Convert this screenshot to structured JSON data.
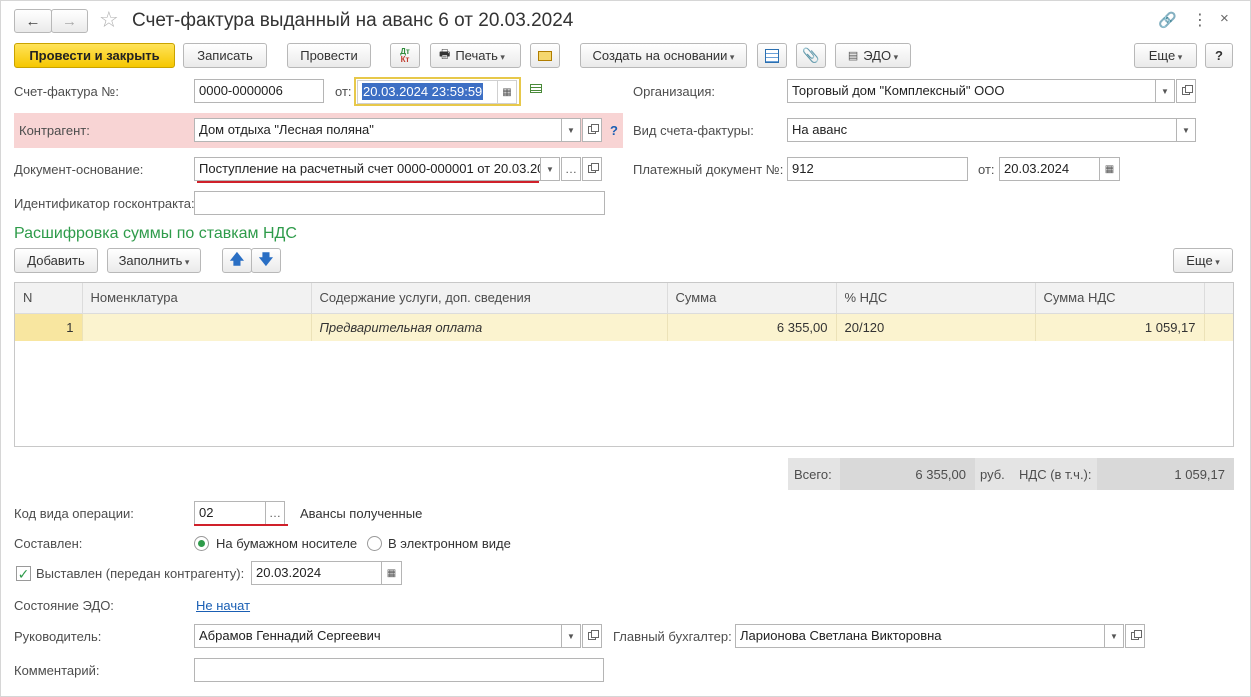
{
  "window": {
    "title": "Счет-фактура выданный на аванс 6 от 20.03.2024"
  },
  "toolbar": {
    "post_close": "Провести и закрыть",
    "save": "Записать",
    "post": "Провести",
    "dtkt_top": "Дт",
    "dtkt_bottom": "Кт",
    "print": "Печать",
    "create_based": "Создать на основании",
    "edo": "ЭДО",
    "more": "Еще",
    "help": "?"
  },
  "form": {
    "invoice_label": "Счет-фактура №:",
    "invoice_number": "0000-0000006",
    "from_label": "от:",
    "invoice_date": "20.03.2024 23:59:59",
    "org_label": "Организация:",
    "org_value": "Торговый дом \"Комплексный\" ООО",
    "counterparty_label": "Контрагент:",
    "counterparty_value": "Дом отдыха \"Лесная поляна\"",
    "question": "?",
    "invoice_type_label": "Вид счета-фактуры:",
    "invoice_type_value": "На аванс",
    "basis_label": "Документ-основание:",
    "basis_value": "Поступление на расчетный счет 0000-000001 от 20.03.20",
    "pay_doc_label": "Платежный документ №:",
    "pay_doc_value": "912",
    "pay_from_label": "от:",
    "pay_date": "20.03.2024",
    "gov_contract_label": "Идентификатор госконтракта:",
    "gov_contract_value": ""
  },
  "section": {
    "title": "Расшифровка суммы по ставкам НДС",
    "add": "Добавить",
    "fill": "Заполнить",
    "more": "Еще"
  },
  "table": {
    "columns": [
      "N",
      "Номенклатура",
      "Содержание услуги, доп. сведения",
      "Сумма",
      "% НДС",
      "Сумма НДС"
    ],
    "rows": [
      {
        "n": "1",
        "nomenclature": "",
        "content": "Предварительная оплата",
        "sum": "6 355,00",
        "vat_rate": "20/120",
        "vat_sum": "1 059,17"
      }
    ]
  },
  "totals": {
    "total_label": "Всего:",
    "total_value": "6 355,00",
    "currency": "руб.",
    "vat_label": "НДС (в т.ч.):",
    "vat_value": "1 059,17"
  },
  "bottom": {
    "op_code_label": "Код вида операции:",
    "op_code_value": "02",
    "op_code_desc": "Авансы полученные",
    "composed_label": "Составлен:",
    "paper_option": "На бумажном носителе",
    "electronic_option": "В электронном виде",
    "issued_label": "Выставлен (передан контрагенту):",
    "issued_date": "20.03.2024",
    "edo_state_label": "Состояние ЭДО:",
    "edo_state_value": "Не начат",
    "head_label": "Руководитель:",
    "head_value": "Абрамов Геннадий Сергеевич",
    "chief_acc_label": "Главный бухгалтер:",
    "chief_acc_value": "Ларионова Светлана Викторовна",
    "comment_label": "Комментарий:",
    "comment_value": ""
  },
  "colors": {
    "accent_yellow": "#f6c700",
    "section_green": "#2e9b4a",
    "link_blue": "#1a5fb4",
    "error_pink": "#f8d4d4",
    "red_underline": "#d0202a"
  }
}
